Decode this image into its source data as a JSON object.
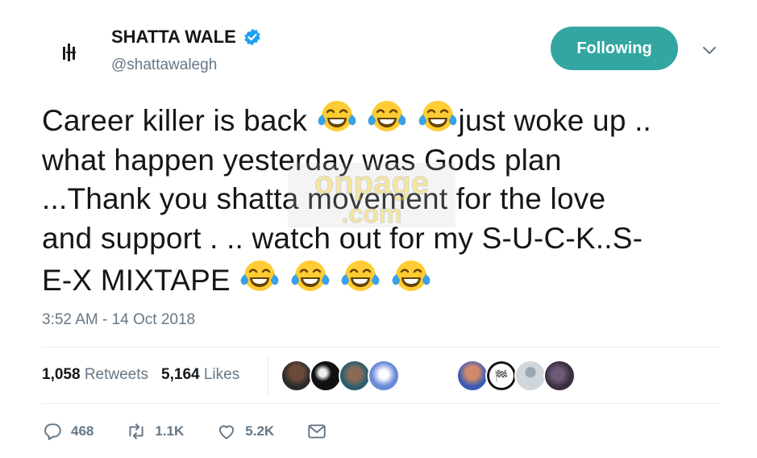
{
  "user": {
    "name": "SHATTA WALE",
    "handle": "@shattawalegh",
    "verified": true
  },
  "follow_button": {
    "label": "Following",
    "color": "#33a6a2"
  },
  "tweet": {
    "lines": [
      {
        "text": "Career killer is back ",
        "emoji_after": 3,
        "suffix": "just woke up .."
      },
      {
        "text": "what happen yesterday was Gods plan"
      },
      {
        "text": "...Thank you shatta movement for the love"
      },
      {
        "text": "and support . .. watch out for my S-U-C-K..S-"
      },
      {
        "text": "E-X MIXTAPE ",
        "emoji_after": 4
      }
    ],
    "emoji": "face-with-tears-of-joy",
    "watermark": [
      "onpage",
      ".com"
    ]
  },
  "timestamp": "3:52 AM - 14 Oct 2018",
  "stats": {
    "retweets_count": "1,058",
    "retweets_label": "Retweets",
    "likes_count": "5,164",
    "likes_label": "Likes"
  },
  "actions": {
    "reply_count": "468",
    "retweet_count": "1.1K",
    "like_count": "5.2K"
  },
  "colors": {
    "text": "#14171a",
    "muted": "#657786",
    "verified": "#1da1f2",
    "divider": "#e6ecf0"
  }
}
